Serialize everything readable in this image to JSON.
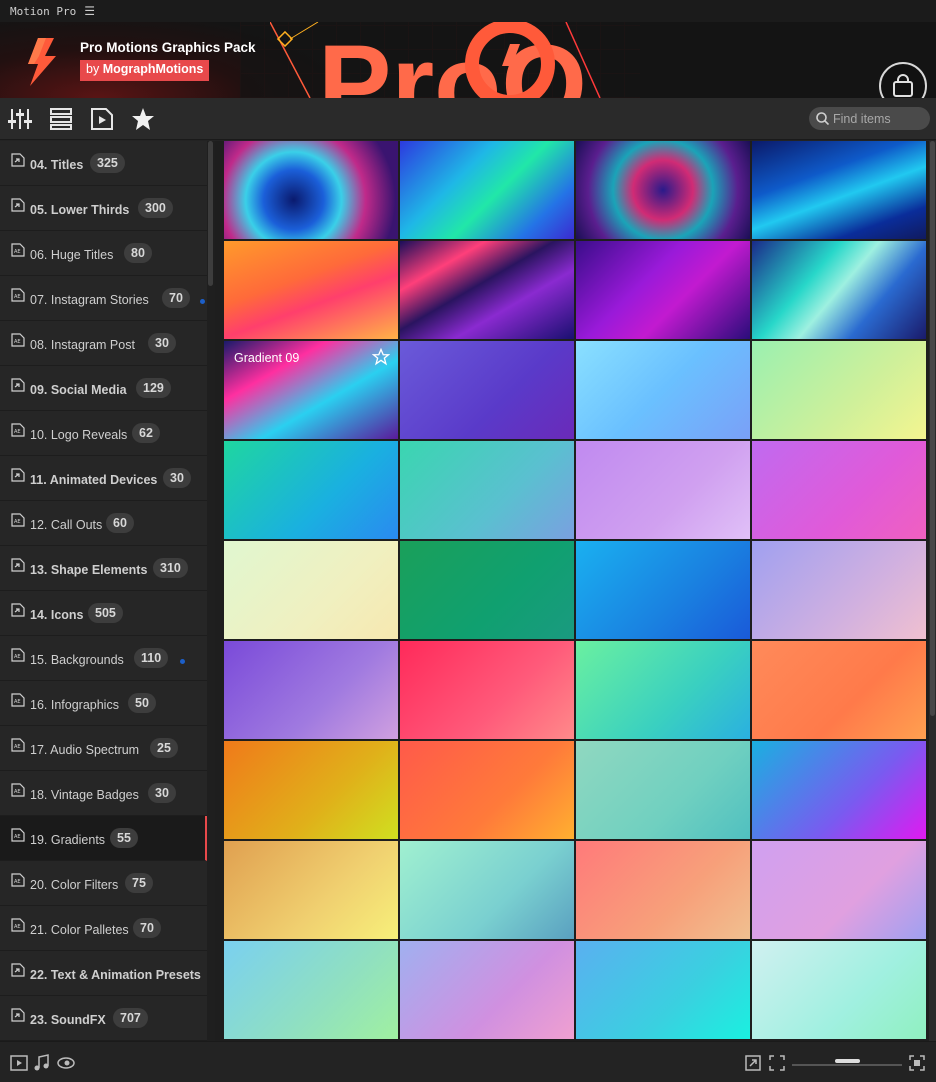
{
  "titlebar": {
    "app_name": "Motion Pro",
    "menu_icon": "hamburger-icon"
  },
  "banner": {
    "title": "Pro Motions Graphics Pack",
    "by_prefix": "by",
    "by_name": "MographMotions",
    "art_text": "ProO",
    "accent_color": "#e8494b"
  },
  "toolbar": {
    "icons": [
      "sliders-icon",
      "list-view-icon",
      "video-preview-icon",
      "star-favorites-icon"
    ],
    "search_placeholder": "Find items"
  },
  "sidebar": {
    "categories": [
      {
        "label": "04. Titles",
        "count": "325",
        "icon": "folder-icon",
        "bold": true
      },
      {
        "label": "05. Lower Thirds",
        "count": "300",
        "icon": "folder-icon",
        "bold": true
      },
      {
        "label": "06. Huge Titles",
        "count": "80",
        "icon": "ae-file-icon",
        "bold": false
      },
      {
        "label": "07. Instagram Stories",
        "count": "70",
        "icon": "ae-file-icon",
        "bold": false,
        "dot": true
      },
      {
        "label": "08. Instagram Post",
        "count": "30",
        "icon": "ae-file-icon",
        "bold": false
      },
      {
        "label": "09. Social Media",
        "count": "129",
        "icon": "folder-icon",
        "bold": true
      },
      {
        "label": "10. Logo Reveals",
        "count": "62",
        "icon": "ae-file-icon",
        "bold": false
      },
      {
        "label": "11. Animated Devices",
        "count": "30",
        "icon": "folder-icon",
        "bold": true
      },
      {
        "label": "12. Call Outs",
        "count": "60",
        "icon": "ae-file-icon",
        "bold": false
      },
      {
        "label": "13. Shape Elements",
        "count": "310",
        "icon": "folder-icon",
        "bold": true
      },
      {
        "label": "14. Icons",
        "count": "505",
        "icon": "folder-icon",
        "bold": true
      },
      {
        "label": "15. Backgrounds",
        "count": "110",
        "icon": "ae-file-icon",
        "bold": false,
        "dot": true
      },
      {
        "label": "16. Infographics",
        "count": "50",
        "icon": "ae-file-icon",
        "bold": false
      },
      {
        "label": "17. Audio Spectrum",
        "count": "25",
        "icon": "ae-file-icon",
        "bold": false
      },
      {
        "label": "18. Vintage Badges",
        "count": "30",
        "icon": "ae-file-icon",
        "bold": false
      },
      {
        "label": "19. Gradients",
        "count": "55",
        "icon": "ae-file-icon",
        "bold": false,
        "active": true
      },
      {
        "label": "20. Color Filters",
        "count": "75",
        "icon": "ae-file-icon",
        "bold": false
      },
      {
        "label": "21. Color Palletes",
        "count": "70",
        "icon": "ae-file-icon",
        "bold": false
      },
      {
        "label": "22. Text & Animation Presets",
        "count": "",
        "icon": "folder-icon",
        "bold": true
      },
      {
        "label": "23. SoundFX",
        "count": "707",
        "icon": "folder-icon",
        "bold": true
      }
    ]
  },
  "gallery": {
    "hovered_tile_name": "Gradient 09",
    "tiles": [
      "radial-gradient(circle at 40% 60%,#0a1a6e 0%,#1b5fd9 25%,#3ad0e8 40%,#c02a8a 60%,#3a1470 85%)",
      "linear-gradient(135deg,#2c3adf 0%,#1fb7e6 35%,#21e7a8 55%,#2473e6 80%,#3b2ad1 100%)",
      "radial-gradient(circle at 50% 50%,#2a1a8a 0%,#d12b75 30%,#1aa4b8 50%,#5a1e8e 75%,#1a0f55 100%)",
      "linear-gradient(160deg,#0b1a6a 0%,#0e5ac9 35%,#21c9f0 55%,#0a2d9a 80%,#101a5e 100%)",
      "linear-gradient(160deg,#ff9a2b 0%,#ff6a3a 40%,#ff3f6c 60%,#ffb347 100%)",
      "linear-gradient(150deg,#1a0e5a 0%,#ff3f7a 25%,#2a1460 45%,#8a2ad0 65%,#1a1070 100%)",
      "linear-gradient(135deg,#3a0d8a 0%,#9a1ad9 40%,#c21ad0 60%,#2a0d7a 100%)",
      "linear-gradient(130deg,#1a2a8a 0%,#27d7c9 35%,#9ef0e0 50%,#2a6ad0 70%,#1a1a6a 100%)",
      "linear-gradient(150deg,#1a1a6a 0%,#ff2fa0 30%,#2ad0f0 60%,#5a1a9a 100%)",
      "linear-gradient(135deg,#6a5ad9 0%,#5a3ac9 60%,#6a2ab9 100%)",
      "linear-gradient(135deg,#8ae0ff 0%,#6ac0ff 50%,#7aa0f7 100%)",
      "linear-gradient(135deg,#9af0b0 0%,#cff09a 60%,#f4f590 100%)",
      "linear-gradient(135deg,#1fd6a0 0%,#1ab0e0 60%,#2a8af0 100%)",
      "linear-gradient(135deg,#3ad6b0 0%,#5ac0d0 60%,#7aa0e0 100%)",
      "linear-gradient(135deg,#c08af0 0%,#d0a0f0 60%,#e0c0f7 100%)",
      "linear-gradient(135deg,#c06af0 0%,#e05ad9 60%,#f060c0 100%)",
      "linear-gradient(135deg,#e0f7d0 0%,#f0f0c0 60%,#f7e8b0 100%)",
      "linear-gradient(135deg,#1aa05a 0%,#10a070 60%,#1a9a80 100%)",
      "linear-gradient(135deg,#1ab0f0 0%,#1a80e0 60%,#1a5ad9 100%)",
      "linear-gradient(135deg,#a0a0f0 0%,#d0b0e0 60%,#f0c0d0 100%)",
      "linear-gradient(135deg,#7a4ad9 0%,#a07ae0 60%,#d0a0e0 100%)",
      "linear-gradient(135deg,#ff2a5a 0%,#ff5a7a 60%,#ff8a8a 100%)",
      "linear-gradient(135deg,#6af0a0 0%,#3ad0c0 60%,#2ab0e0 100%)",
      "linear-gradient(135deg,#ff8a5a 0%,#ff7a4a 60%,#ffa050 100%)",
      "linear-gradient(135deg,#f07a1a 0%,#e0b01a 60%,#d0e020 100%)",
      "linear-gradient(135deg,#ff5a4a 0%,#ff7a3a 60%,#ffb030 100%)",
      "linear-gradient(135deg,#90d8c0 0%,#70d0c0 60%,#50c0c0 100%)",
      "linear-gradient(135deg,#1ab0e0 0%,#7a5af0 60%,#e01af0 100%)",
      "linear-gradient(135deg,#e0a050 0%,#f0d070 60%,#f7f07a 100%)",
      "linear-gradient(135deg,#a0f0d0 0%,#7ad0d0 60%,#5aa0c0 100%)",
      "linear-gradient(135deg,#ff7a7a 0%,#f7a07a 60%,#f0c090 100%)",
      "linear-gradient(135deg,#d0a0f0 0%,#e0a0e0 60%,#a0a0f0 100%)",
      "linear-gradient(135deg,#7ad0f0 0%,#90e0c0 60%,#a0f0a0 100%)",
      "linear-gradient(135deg,#a0b0f0 0%,#d090e0 60%,#f0a0d0 100%)",
      "linear-gradient(135deg,#5ab0f0 0%,#3ad0e0 60%,#1af0e0 100%)",
      "linear-gradient(135deg,#d0f0f0 0%,#a0f0e0 60%,#90f0c0 100%)"
    ]
  },
  "bottombar": {
    "icons": [
      "play-icon",
      "music-note-icon",
      "eye-icon",
      "fit-window-icon",
      "fullscreen-icon",
      "expand-icon"
    ]
  }
}
